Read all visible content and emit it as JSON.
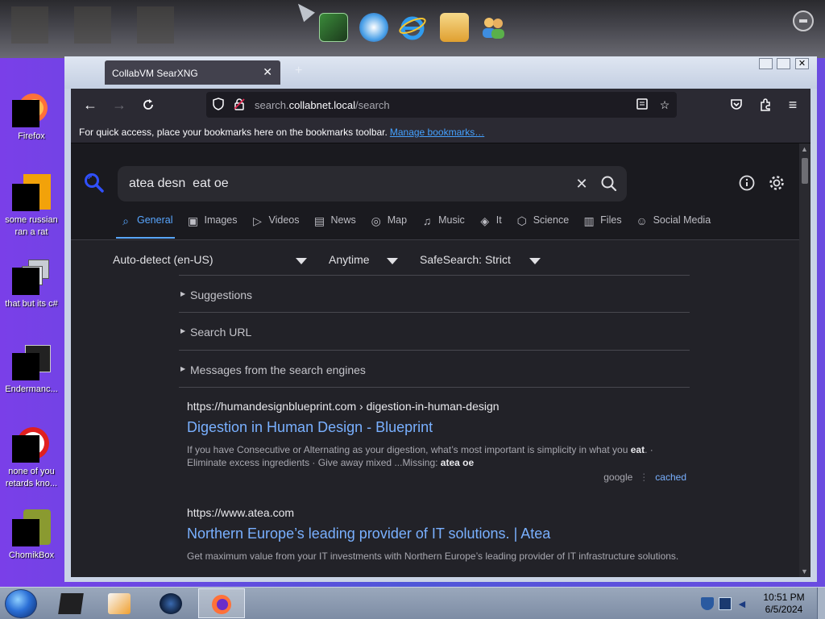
{
  "desktop": {
    "top_dock_hint": "",
    "icons": [
      {
        "label": "Firefox",
        "icon": "firefox-icon"
      },
      {
        "label": "some russian ran a rat",
        "icon": "app-icon"
      },
      {
        "label": "that but its c#",
        "icon": "windows-stack-icon"
      },
      {
        "label": "Endermanc...",
        "icon": "terminal-icon"
      },
      {
        "label": "none of you retards kno...",
        "icon": "red-circle-icon"
      },
      {
        "label": "ChomikBox",
        "icon": "chomikbox-icon"
      }
    ]
  },
  "browser": {
    "tab_title": "CollabVM SearXNG",
    "url_prefix": "search.",
    "url_domain": "collabnet.local",
    "url_path": "/search",
    "bookmarks_text": "For quick access, place your bookmarks here on the bookmarks toolbar.",
    "bookmarks_link": "Manage bookmarks…"
  },
  "searx": {
    "query": "atea desn  eat oe",
    "categories": [
      {
        "label": "General",
        "icon": "search-icon",
        "active": true
      },
      {
        "label": "Images",
        "icon": "image-icon"
      },
      {
        "label": "Videos",
        "icon": "play-icon"
      },
      {
        "label": "News",
        "icon": "newspaper-icon"
      },
      {
        "label": "Map",
        "icon": "map-pin-icon"
      },
      {
        "label": "Music",
        "icon": "music-note-icon"
      },
      {
        "label": "It",
        "icon": "layers-icon"
      },
      {
        "label": "Science",
        "icon": "science-icon"
      },
      {
        "label": "Files",
        "icon": "files-icon"
      },
      {
        "label": "Social Media",
        "icon": "people-icon"
      }
    ],
    "filters": {
      "language": "Auto-detect (en-US)",
      "time": "Anytime",
      "safesearch": "SafeSearch: Strict"
    },
    "sections": {
      "suggestions": "Suggestions",
      "search_url": "Search URL",
      "messages": "Messages from the search engines"
    },
    "results": [
      {
        "url": "https://humandesignblueprint.com",
        "path": "› digestion-in-human-design",
        "title": "Digestion in Human Design - Blueprint",
        "snippet_a": "If you have Consecutive or Alternating as your digestion, what’s most important is simplicity in what you ",
        "snippet_bold1": "eat",
        "snippet_b": ". · Eliminate excess ingredients · Give away mixed ...Missing: ",
        "snippet_bold2": "atea oe",
        "engine": "google",
        "cached": "cached"
      },
      {
        "url": "https://www.atea.com",
        "title": "Northern Europe’s leading provider of IT solutions. | Atea",
        "snippet": "Get maximum value from your IT investments with Northern Europe’s leading provider of IT infrastructure solutions."
      }
    ]
  },
  "taskbar": {
    "time": "10:51 PM",
    "date": "6/5/2024"
  },
  "colors": {
    "accent": "#58a6ff",
    "link": "#79b0ff",
    "page_bg": "#222228",
    "toolbar_bg": "#2b2a33"
  }
}
